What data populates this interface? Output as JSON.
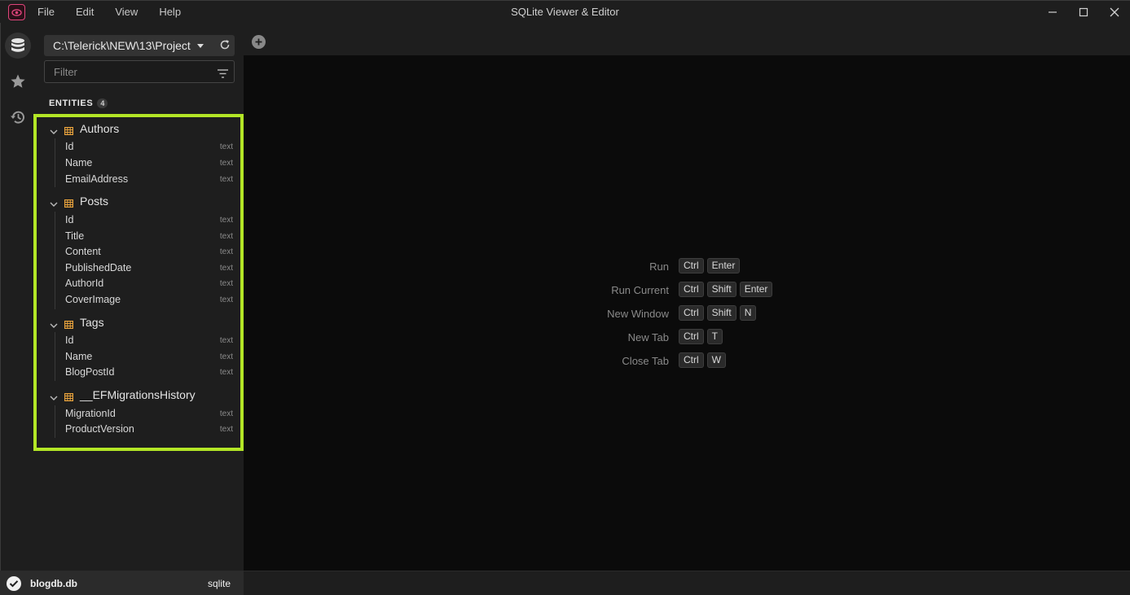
{
  "app": {
    "title": "SQLite Viewer & Editor",
    "menu": [
      "File",
      "Edit",
      "View",
      "Help"
    ]
  },
  "sidebar": {
    "path": "C:\\Telerick\\NEW\\13\\Project",
    "filter_placeholder": "Filter",
    "entities_label": "ENTITIES",
    "entities_count": "4",
    "tables": [
      {
        "name": "Authors",
        "columns": [
          {
            "name": "Id",
            "type": "text"
          },
          {
            "name": "Name",
            "type": "text"
          },
          {
            "name": "EmailAddress",
            "type": "text"
          }
        ]
      },
      {
        "name": "Posts",
        "columns": [
          {
            "name": "Id",
            "type": "text"
          },
          {
            "name": "Title",
            "type": "text"
          },
          {
            "name": "Content",
            "type": "text"
          },
          {
            "name": "PublishedDate",
            "type": "text"
          },
          {
            "name": "AuthorId",
            "type": "text"
          },
          {
            "name": "CoverImage",
            "type": "text"
          }
        ]
      },
      {
        "name": "Tags",
        "columns": [
          {
            "name": "Id",
            "type": "text"
          },
          {
            "name": "Name",
            "type": "text"
          },
          {
            "name": "BlogPostId",
            "type": "text"
          }
        ]
      },
      {
        "name": "__EFMigrationsHistory",
        "columns": [
          {
            "name": "MigrationId",
            "type": "text"
          },
          {
            "name": "ProductVersion",
            "type": "text"
          }
        ]
      }
    ]
  },
  "shortcuts": [
    {
      "label": "Run",
      "keys": [
        "Ctrl",
        "Enter"
      ]
    },
    {
      "label": "Run Current",
      "keys": [
        "Ctrl",
        "Shift",
        "Enter"
      ]
    },
    {
      "label": "New Window",
      "keys": [
        "Ctrl",
        "Shift",
        "N"
      ]
    },
    {
      "label": "New Tab",
      "keys": [
        "Ctrl",
        "T"
      ]
    },
    {
      "label": "Close Tab",
      "keys": [
        "Ctrl",
        "W"
      ]
    }
  ],
  "status": {
    "db_name": "blogdb.db",
    "db_type": "sqlite"
  },
  "colors": {
    "highlight": "#b3e626",
    "table_icon": "#e8a33d",
    "app_icon": "#e0457b"
  }
}
